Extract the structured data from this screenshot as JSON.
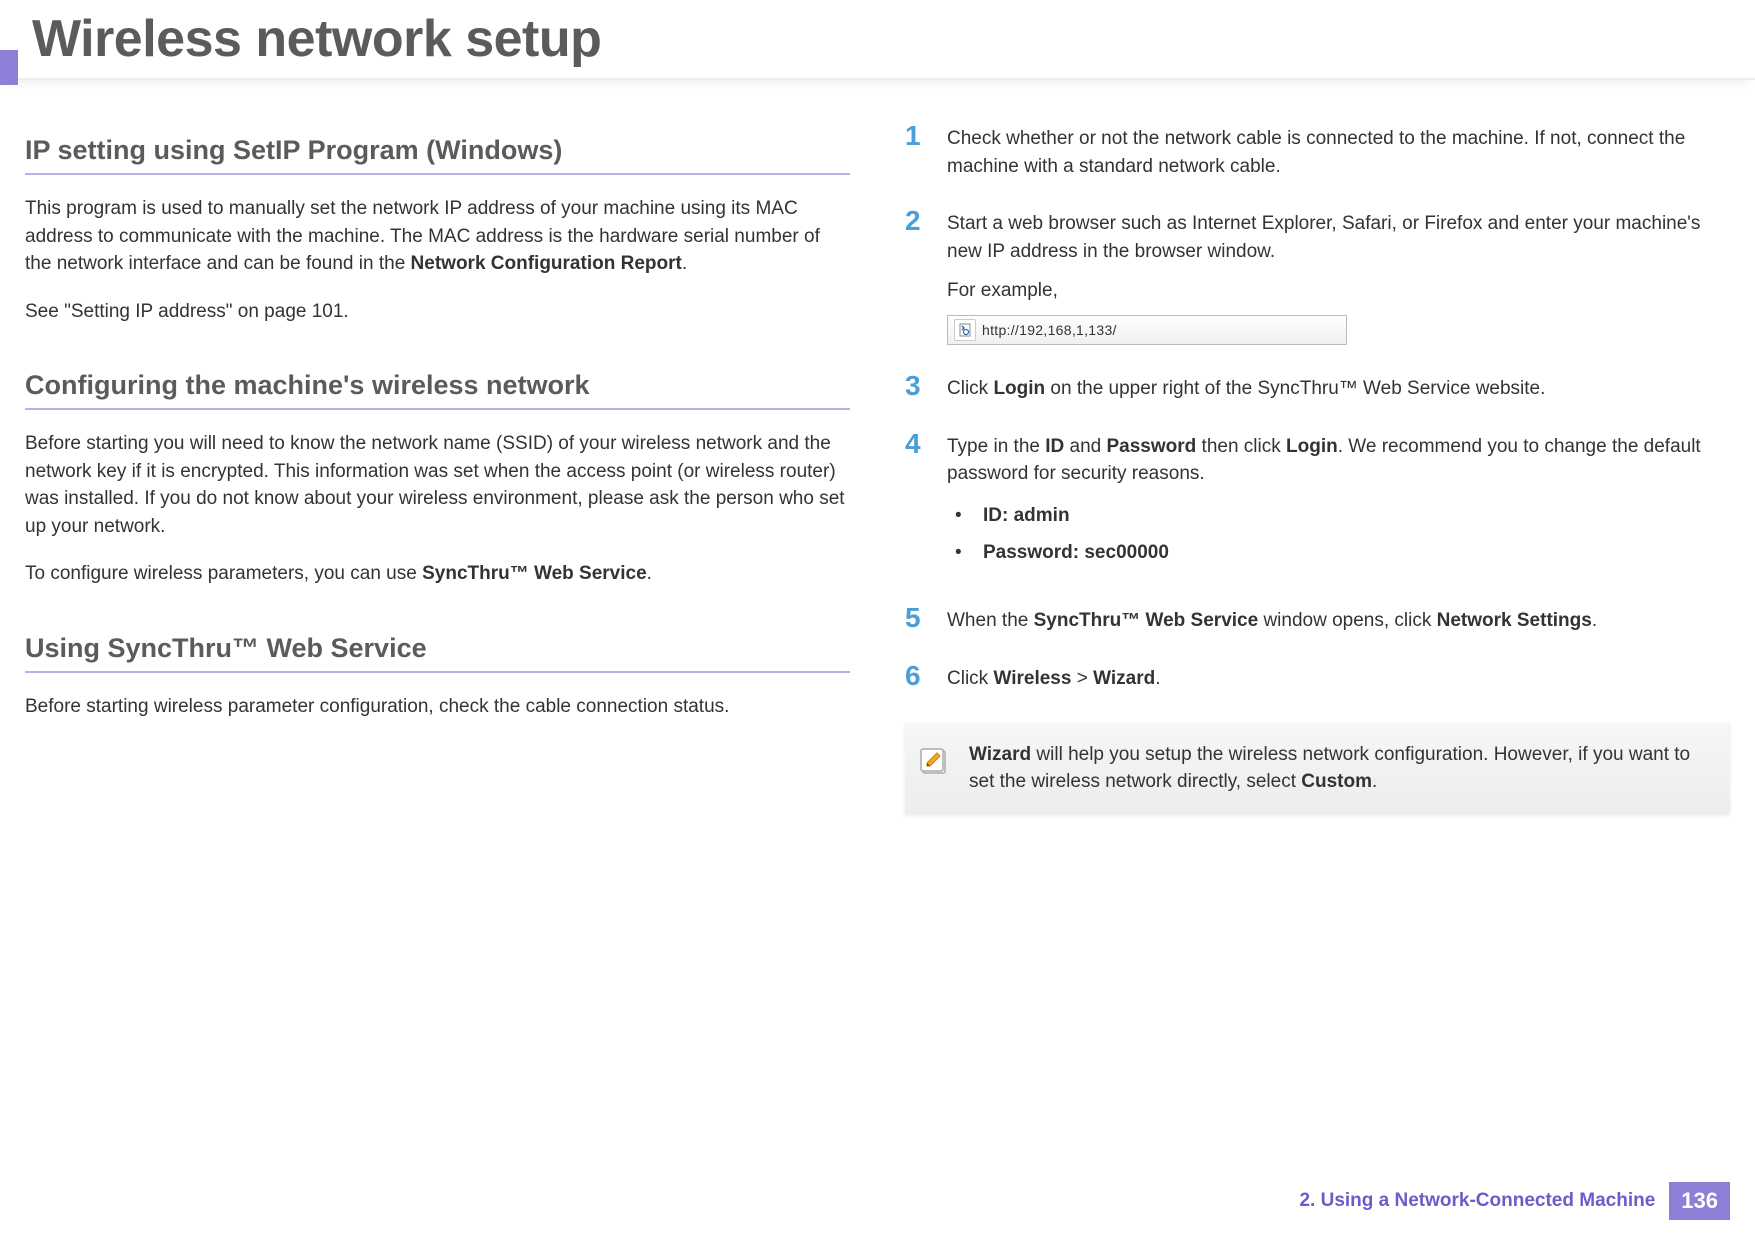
{
  "header": {
    "title": "Wireless network setup"
  },
  "left": {
    "section1": {
      "heading": "IP setting using SetIP Program (Windows)",
      "para1_a": "This program is used to manually set the network IP address of your machine using its MAC address to communicate with the machine. The MAC address is the hardware serial number of the network interface and can be found in the ",
      "para1_b": "Network Configuration Report",
      "para1_c": ".",
      "para2": "See \"Setting IP address\" on page 101."
    },
    "section2": {
      "heading": "Configuring the machine's wireless network",
      "para1": "Before starting you will need to know the network name (SSID) of your wireless network and the network key if it is encrypted. This information was set when the access point (or wireless router) was installed. If you do not know about your wireless environment, please ask the person who set up your network.",
      "para2_a": "To configure wireless parameters, you can use ",
      "para2_b": "SyncThru™ Web Service",
      "para2_c": "."
    },
    "section3": {
      "heading": "Using SyncThru™ Web Service",
      "para1": "Before starting wireless parameter configuration, check the cable connection status."
    }
  },
  "right": {
    "step1": {
      "num": "1",
      "text": "Check whether or not the network cable is connected to the machine. If not, connect the machine with a standard network cable."
    },
    "step2": {
      "num": "2",
      "text": "Start a web browser such as Internet Explorer, Safari, or Firefox and enter your machine's new IP address in the browser window.",
      "sub": "For example,",
      "url": "http://192,168,1,133/"
    },
    "step3": {
      "num": "3",
      "text_a": "Click ",
      "text_b": "Login",
      "text_c": " on the upper right of the SyncThru™ Web Service website."
    },
    "step4": {
      "num": "4",
      "text_a": "Type in the ",
      "text_b": "ID",
      "text_c": " and ",
      "text_d": "Password",
      "text_e": " then click ",
      "text_f": "Login",
      "text_g": ". We recommend you to change the default password for security reasons.",
      "bullet1": "ID: admin",
      "bullet2": "Password: sec00000"
    },
    "step5": {
      "num": "5",
      "text_a": "When the ",
      "text_b": "SyncThru™ Web Service",
      "text_c": " window opens, click ",
      "text_d": "Network Settings",
      "text_e": "."
    },
    "step6": {
      "num": "6",
      "text_a": "Click ",
      "text_b": "Wireless",
      "text_c": " > ",
      "text_d": "Wizard",
      "text_e": "."
    },
    "note": {
      "text_a": "Wizard",
      "text_b": " will help you setup the wireless network configuration. However, if you want to set the wireless network directly, select ",
      "text_c": "Custom",
      "text_d": "."
    }
  },
  "footer": {
    "label": "2.  Using a Network-Connected Machine",
    "page": "136"
  }
}
